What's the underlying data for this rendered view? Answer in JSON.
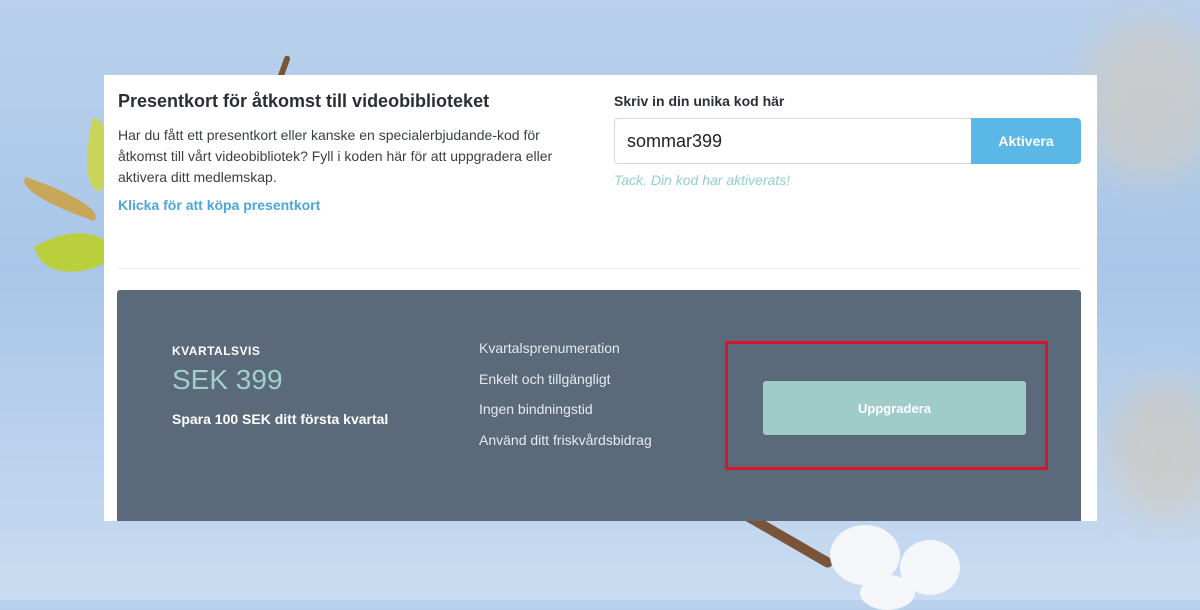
{
  "gift": {
    "title": "Presentkort för åtkomst till videobiblioteket",
    "description": "Har du fått ett presentkort eller kanske en specialerbjudande-kod för åtkomst till vårt videobibliotek? Fyll i koden här för att uppgradera eller aktivera ditt medlemskap.",
    "buy_link": "Klicka för att köpa presentkort"
  },
  "code": {
    "label": "Skriv in din unika kod här",
    "value": "sommar399",
    "button_label": "Aktivera",
    "success_message": "Tack. Din kod har aktiverats!"
  },
  "plan": {
    "period": "KVARTALSVIS",
    "price": "SEK 399",
    "savings": "Spara 100 SEK ditt första kvartal",
    "features": [
      "Kvartalsprenumeration",
      "Enkelt och tillgängligt",
      "Ingen bindningstid",
      "Använd ditt friskvårdsbidrag"
    ],
    "upgrade_label": "Uppgradera"
  },
  "colors": {
    "accent": "#5bb7e6",
    "success": "#8fd0ce",
    "plan_bg": "#5a6a7a",
    "upgrade_button": "#9fccc9",
    "highlight": "#d7162a"
  }
}
